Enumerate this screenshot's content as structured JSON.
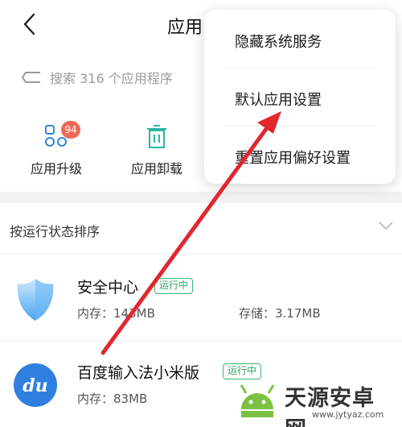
{
  "header": {
    "title": "应用"
  },
  "search": {
    "placeholder": "搜索 316 个应用程序"
  },
  "quick_actions": [
    {
      "label": "应用升级",
      "badge": "94"
    },
    {
      "label": "应用卸载"
    }
  ],
  "sort": {
    "label": "按运行状态排序"
  },
  "apps": [
    {
      "name": "安全中心",
      "status": "运行中",
      "memory": "内存：143MB",
      "storage": "存储：3.17MB"
    },
    {
      "name": "百度输入法小米版",
      "status": "运行中",
      "memory": "内存：83MB",
      "icon_text": "du"
    }
  ],
  "menu": {
    "items": [
      "隐藏系统服务",
      "默认应用设置",
      "重置应用偏好设置"
    ]
  },
  "watermark": {
    "name": "天源安卓网",
    "url": "www.jytyaz.com"
  },
  "colors": {
    "badge": "#f06a5a",
    "status_green": "#2ea663",
    "arrow": "#e0282e",
    "accent_teal": "#2bb5a6"
  }
}
